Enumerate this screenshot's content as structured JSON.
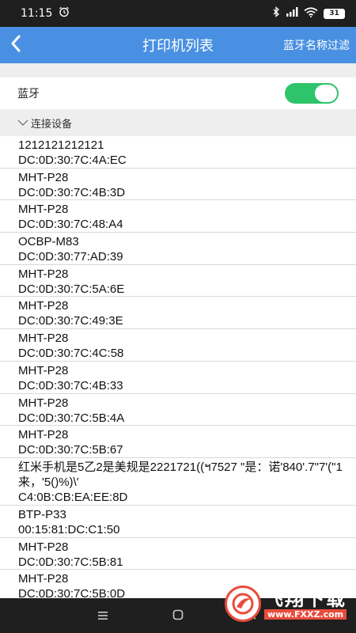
{
  "status_bar": {
    "time": "11:15",
    "battery": "31"
  },
  "app_bar": {
    "title": "打印机列表",
    "filter_label": "蓝牙名称过滤"
  },
  "bluetooth": {
    "label": "蓝牙",
    "enabled": true
  },
  "section": {
    "label": "连接设备"
  },
  "devices": [
    {
      "name": "1212121212121",
      "address": "DC:0D:30:7C:4A:EC"
    },
    {
      "name": "MHT-P28",
      "address": "DC:0D:30:7C:4B:3D"
    },
    {
      "name": "MHT-P28",
      "address": "DC:0D:30:7C:48:A4"
    },
    {
      "name": "OCBP-M83",
      "address": "DC:0D:30:77:AD:39"
    },
    {
      "name": "MHT-P28",
      "address": "DC:0D:30:7C:5A:6E"
    },
    {
      "name": "MHT-P28",
      "address": "DC:0D:30:7C:49:3E"
    },
    {
      "name": "MHT-P28",
      "address": "DC:0D:30:7C:4C:58"
    },
    {
      "name": "MHT-P28",
      "address": "DC:0D:30:7C:4B:33"
    },
    {
      "name": "MHT-P28",
      "address": "DC:0D:30:7C:5B:4A"
    },
    {
      "name": "MHT-P28",
      "address": "DC:0D:30:7C:5B:67"
    },
    {
      "name": "红米手机是5乙2是美规是2221721((ฯ7527 \"是：诺'840'.7\"7'(\"1来，'5()%)\\'",
      "address": "C4:0B:CB:EA:EE:8D"
    },
    {
      "name": "BTP-P33",
      "address": "00:15:81:DC:C1:50"
    },
    {
      "name": "MHT-P28",
      "address": "DC:0D:30:7C:5B:81"
    },
    {
      "name": "MHT-P28",
      "address": "DC:0D:30:7C:5B:0D"
    }
  ],
  "watermark": {
    "title": "飞翔下载",
    "url": "www.FXXZ.com"
  },
  "colors": {
    "app_bar": "#4a90e2",
    "toggle_on": "#2ec46c",
    "section_bg": "#eeeeee",
    "watermark_accent": "#e84c3d"
  }
}
